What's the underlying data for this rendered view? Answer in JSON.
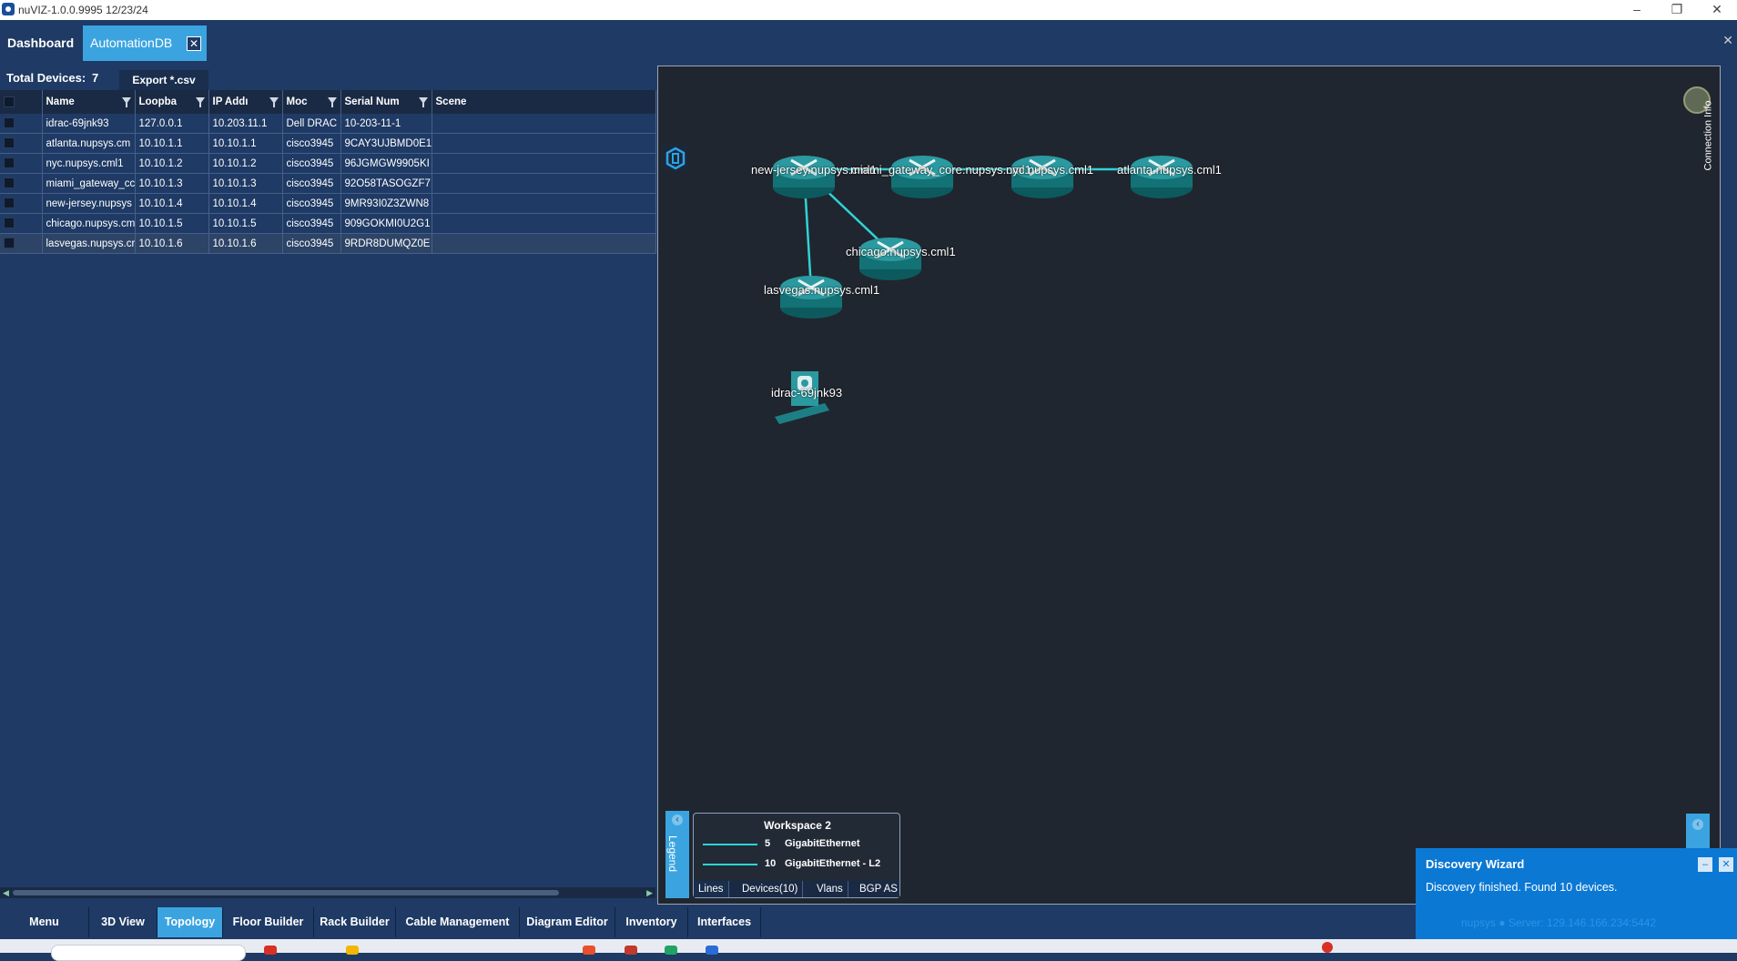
{
  "window": {
    "title": "nuVIZ-1.0.0.9995 12/23/24"
  },
  "tabs": [
    {
      "label": "Dashboard"
    },
    {
      "label": "AutomationDB",
      "close": "✕"
    }
  ],
  "left": {
    "total_label": "Total Devices:",
    "total_count": "7",
    "export_label": "Export *.csv"
  },
  "table": {
    "columns": [
      "Name",
      "Loopba",
      "IP Addı",
      "Moc",
      "Serial Num",
      "Scene"
    ],
    "rows": [
      [
        "idrac-69jnk93",
        "127.0.0.1",
        "10.203.11.1",
        "Dell DRAC",
        "10-203-11-1"
      ],
      [
        "atlanta.nupsys.cm",
        "10.10.1.1",
        "10.10.1.1",
        "cisco3945",
        "9CAY3UJBMD0E1"
      ],
      [
        "nyc.nupsys.cml1",
        "10.10.1.2",
        "10.10.1.2",
        "cisco3945",
        "96JGMGW9905KI"
      ],
      [
        "miami_gateway_cc",
        "10.10.1.3",
        "10.10.1.3",
        "cisco3945",
        "92O58TASOGZF7"
      ],
      [
        "new-jersey.nupsys",
        "10.10.1.4",
        "10.10.1.4",
        "cisco3945",
        "9MR93I0Z3ZWN8"
      ],
      [
        "chicago.nupsys.cm",
        "10.10.1.5",
        "10.10.1.5",
        "cisco3945",
        "909GOKMI0U2G1"
      ],
      [
        "lasvegas.nupsys.cr",
        "10.10.1.6",
        "10.10.1.6",
        "cisco3945",
        "9RDR8DUMQZ0E"
      ]
    ]
  },
  "topology": {
    "connection_info": "Connection Info",
    "devices": [
      {
        "label": "new-jersey.nupsys.cml1"
      },
      {
        "label": "miami_gateway_core.nupsys.cml1"
      },
      {
        "label": "nyc.nupsys.cml1"
      },
      {
        "label": "atlanta.nupsys.cml1"
      },
      {
        "label": "chicago.nupsys.cml1"
      },
      {
        "label": "lasvegas.nupsys.cml1"
      },
      {
        "label": "idrac-69jnk93"
      }
    ],
    "link_color": "#2fd3d6"
  },
  "legend": {
    "tab_label": "Legend",
    "title": "Workspace 2",
    "rows": [
      {
        "count": "5",
        "name": "GigabitEthernet",
        "color": "#2fd3d6"
      },
      {
        "count": "10",
        "name": "GigabitEthernet - L2",
        "color": "#2fd3d6"
      }
    ],
    "tabs": [
      "Lines",
      "Devices(10)",
      "Vlans",
      "BGP AS"
    ]
  },
  "bottom_toolbar": {
    "items": [
      "Menu",
      "3D View",
      "Topology",
      "Floor Builder",
      "Rack Builder",
      "Cable Management",
      "Diagram Editor",
      "Inventory",
      "Interfaces"
    ],
    "active": "Topology"
  },
  "toast": {
    "title": "Discovery Wizard",
    "message": "Discovery finished. Found 10 devices.",
    "footer": "nupsys  ●  Server: 129.146.166.234:5442"
  },
  "colors": {
    "accent": "#3ba4e0",
    "panel_bg": "#1f3a64",
    "canvas_bg": "#20262f",
    "toast_bg": "#0b78d4"
  }
}
